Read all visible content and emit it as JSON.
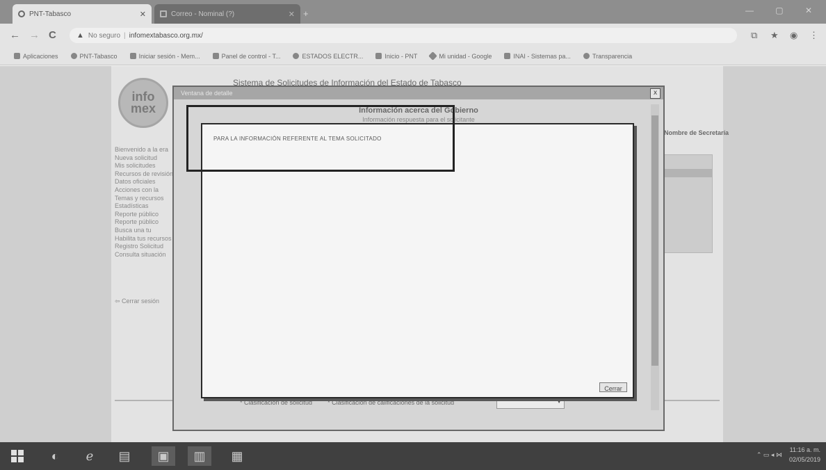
{
  "browser": {
    "tabs": [
      {
        "label": "PNT-Tabasco",
        "active": true
      },
      {
        "label": "Correo - Nominal (?)",
        "active": false
      }
    ],
    "new_tab": "+",
    "window_controls": "— ▢ ✕",
    "nav": {
      "back": "←",
      "forward": "→",
      "reload": "C"
    },
    "omnibox": {
      "security_label": "No seguro",
      "url": "infomextabasco.org.mx/"
    },
    "bookmarks": [
      "Aplicaciones",
      "PNT-Tabasco",
      "Iniciar sesión - Mem...",
      "Panel de control - T...",
      "ESTADOS ELECTR...",
      "Inicio - PNT",
      "Mi unidad - Google",
      "INAI - Sistemas pa...",
      "Transparencia"
    ]
  },
  "page": {
    "logo_text": "info mex",
    "system_title": "Sistema de Solicitudes de Información del Estado de Tabasco",
    "nav_links": [
      "Bienvenido a la era",
      "Nueva solicitud",
      "Mis solicitudes",
      "Recursos de revisión",
      "Datos oficiales",
      "Acciones con la",
      "Temas y recursos",
      "Estadísticas",
      "Reporte público",
      "Reporte público",
      "Busca una tu",
      "Habilita tus recursos",
      "Registro Solicitud",
      "Consulta situación"
    ],
    "exit_link": "Cerrar sesión",
    "side_title": "Nombre de Secretaría"
  },
  "outer_dialog": {
    "title": "Ventana de detalle",
    "close": "x",
    "heading": "Información acerca del Gobierno",
    "subheading": "Información respuesta para el solicitante",
    "footer_items": [
      "* Clasificación de solicitud",
      "* Clasificación de calificaciones de la solicitud"
    ],
    "rating_value": ""
  },
  "inner_modal": {
    "message": "PARA LA INFORMACIÓN REFERENTE AL TEMA SOLICITADO",
    "close_button": "Cerrar"
  },
  "taskbar": {
    "apps": [
      "firefox",
      "internet-explorer",
      "file-explorer",
      "folder",
      "word",
      "excel"
    ],
    "time": "11:16 a. m.",
    "date": "02/05/2019"
  }
}
